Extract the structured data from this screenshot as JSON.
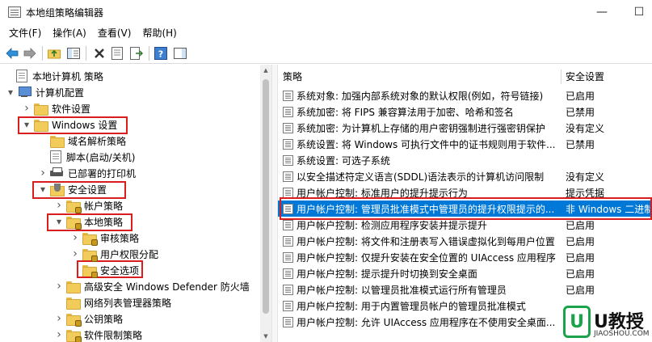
{
  "window": {
    "title": "本地组策略编辑器",
    "minimize": "—",
    "maximize": "☐"
  },
  "menu": [
    "文件(F)",
    "操作(A)",
    "查看(V)",
    "帮助(H)"
  ],
  "tree": [
    {
      "label": "本地计算机 策略",
      "icon": "document-icon",
      "twisty": ""
    },
    {
      "label": "计算机配置",
      "icon": "computer-icon",
      "twisty": "expanded"
    },
    {
      "label": "软件设置",
      "icon": "folder-icon",
      "twisty": "collapsed"
    },
    {
      "label": "Windows 设置",
      "icon": "folder-icon",
      "twisty": "expanded"
    },
    {
      "label": "域名解析策略",
      "icon": "folder-icon",
      "twisty": ""
    },
    {
      "label": "脚本(启动/关机)",
      "icon": "document-icon",
      "twisty": ""
    },
    {
      "label": "已部署的打印机",
      "icon": "printer-icon",
      "twisty": "collapsed"
    },
    {
      "label": "安全设置",
      "icon": "shield-folder-icon",
      "twisty": "expanded"
    },
    {
      "label": "帐户策略",
      "icon": "locked-folder-icon",
      "twisty": "collapsed"
    },
    {
      "label": "本地策略",
      "icon": "locked-folder-icon",
      "twisty": "expanded"
    },
    {
      "label": "审核策略",
      "icon": "locked-folder-icon",
      "twisty": "collapsed"
    },
    {
      "label": "用户权限分配",
      "icon": "locked-folder-icon",
      "twisty": "collapsed"
    },
    {
      "label": "安全选项",
      "icon": "locked-folder-icon",
      "twisty": ""
    },
    {
      "label": "高级安全 Windows Defender 防火墙",
      "icon": "folder-icon",
      "twisty": "collapsed"
    },
    {
      "label": "网络列表管理器策略",
      "icon": "folder-icon",
      "twisty": ""
    },
    {
      "label": "公钥策略",
      "icon": "locked-folder-icon",
      "twisty": "collapsed"
    },
    {
      "label": "软件限制策略",
      "icon": "locked-folder-icon",
      "twisty": "collapsed"
    }
  ],
  "columns": {
    "policy": "策略",
    "setting": "安全设置"
  },
  "policies": [
    {
      "name": "系统对象: 加强内部系统对象的默认权限(例如，符号链接)",
      "setting": "已启用"
    },
    {
      "name": "系统加密: 将 FIPS 兼容算法用于加密、哈希和签名",
      "setting": "已禁用"
    },
    {
      "name": "系统加密: 为计算机上存储的用户密钥强制进行强密钥保护",
      "setting": "没有定义"
    },
    {
      "name": "系统设置: 将 Windows 可执行文件中的证书规则用于软件...",
      "setting": "已禁用"
    },
    {
      "name": "系统设置: 可选子系统",
      "setting": ""
    },
    {
      "name": "以安全描述符定义语言(SDDL)语法表示的计算机访问限制",
      "setting": "没有定义"
    },
    {
      "name": "用户帐户控制: 标准用户的提升提示行为",
      "setting": "提示凭据"
    },
    {
      "name": "用户帐户控制: 管理员批准模式中管理员的提升权限提示的...",
      "setting": "非 Windows 二进制"
    },
    {
      "name": "用户帐户控制: 检测应用程序安装并提示提升",
      "setting": "已启用"
    },
    {
      "name": "用户帐户控制: 将文件和注册表写入错误虚拟化到每用户位置",
      "setting": "已启用"
    },
    {
      "name": "用户帐户控制: 仅提升安装在安全位置的 UIAccess 应用程序",
      "setting": "已启用"
    },
    {
      "name": "用户帐户控制: 提示提升时切换到安全桌面",
      "setting": "已启用"
    },
    {
      "name": "用户帐户控制: 以管理员批准模式运行所有管理员",
      "setting": "已启用"
    },
    {
      "name": "用户帐户控制: 用于内置管理员帐户的管理员批准模式",
      "setting": ""
    },
    {
      "name": "用户帐户控制: 允许 UIAccess 应用程序在不使用安全桌面...",
      "setting": ""
    }
  ],
  "selected_policy_index": 7,
  "watermark": {
    "logo": "U",
    "brand": "U教授",
    "site": "JIAOSHOU.COM"
  },
  "colors": {
    "selection": "#0078d7",
    "highlight_box": "#d81e1e",
    "watermark_green": "#1aa34a"
  }
}
